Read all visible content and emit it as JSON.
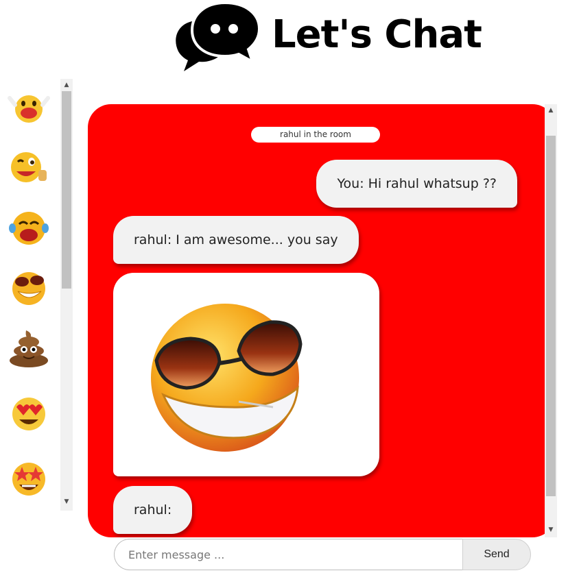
{
  "app": {
    "title": "Let's Chat",
    "logo_icon": "chat-bubbles-icon"
  },
  "emoji_panel": {
    "items": [
      {
        "name": "cheering-emoji"
      },
      {
        "name": "winking-thumbs-up-emoji"
      },
      {
        "name": "crying-laughing-emoji"
      },
      {
        "name": "cool-sunglasses-emoji"
      },
      {
        "name": "poop-emoji"
      },
      {
        "name": "heart-eyes-emoji"
      },
      {
        "name": "star-struck-emoji"
      }
    ]
  },
  "chat": {
    "room_notice": "rahul in the room",
    "messages": [
      {
        "type": "sent",
        "text": "You: Hi rahul whatsup ??"
      },
      {
        "type": "received",
        "text": "rahul: I am awesome... you say"
      },
      {
        "type": "received-image",
        "image": "cool-sunglasses-emoji"
      },
      {
        "type": "received",
        "text": "rahul:"
      }
    ],
    "accent_color": "#ff0000"
  },
  "composer": {
    "placeholder": "Enter message ...",
    "value": "",
    "send_label": "Send"
  }
}
